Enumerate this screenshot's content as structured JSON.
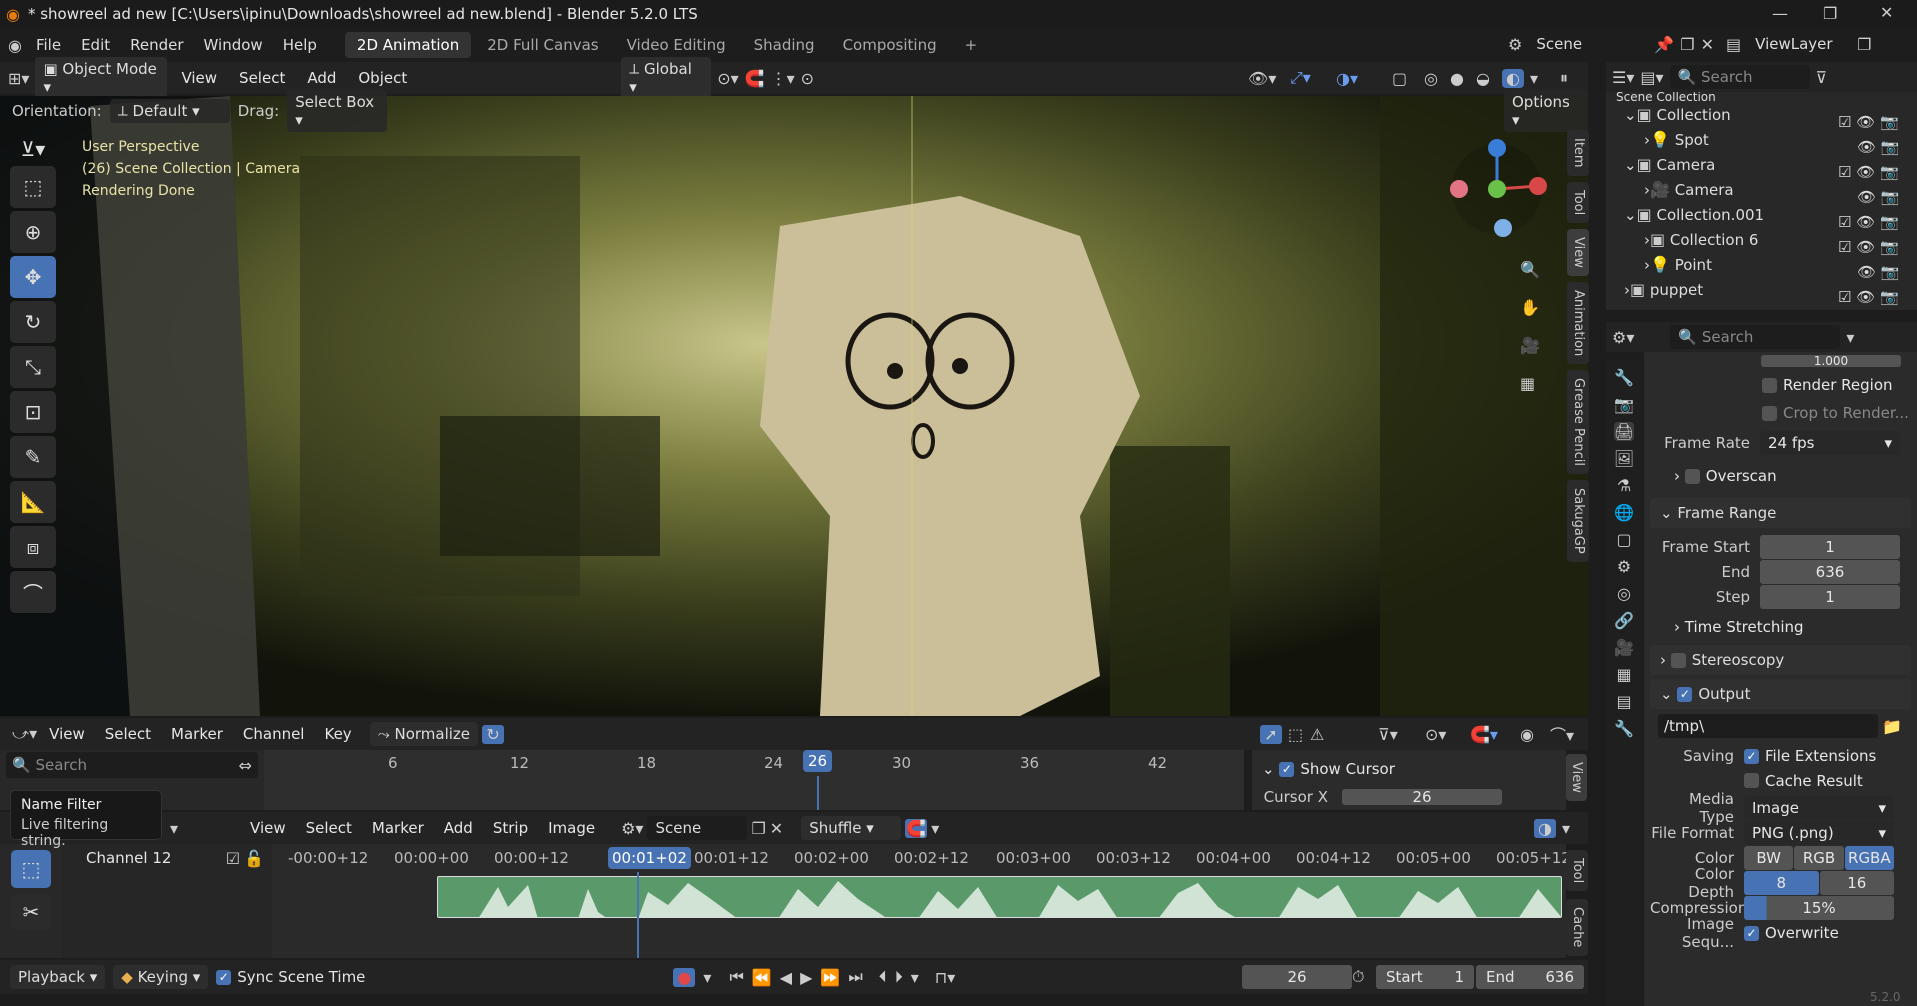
{
  "titlebar": {
    "title": "* showreel ad new [C:\\Users\\ipinu\\Downloads\\showreel ad new.blend] - Blender 5.2.0 LTS"
  },
  "menu": [
    "File",
    "Edit",
    "Render",
    "Window",
    "Help"
  ],
  "workspaces": [
    "2D Animation",
    "2D Full Canvas",
    "Video Editing",
    "Shading",
    "Compositing"
  ],
  "scene": {
    "name": "Scene",
    "viewlayer": "ViewLayer"
  },
  "viewport_header": {
    "mode": "Object Mode",
    "menus": [
      "View",
      "Select",
      "Add",
      "Object"
    ],
    "transform": "Global"
  },
  "tool_settings": {
    "orientation_label": "Orientation:",
    "orientation_value": "Default",
    "drag_label": "Drag:",
    "drag_value": "Select Box",
    "options": "Options"
  },
  "viewport_overlay": {
    "line1": "User Perspective",
    "line2": "(26) Scene Collection | Camera",
    "line3": "Rendering Done"
  },
  "sidebar_tabs": [
    "Item",
    "Tool",
    "View",
    "Animation",
    "Grease Pencil",
    "SakugaGP"
  ],
  "outliner": {
    "search_placeholder": "Search",
    "rows": [
      {
        "label": "Scene Collection"
      },
      {
        "label": "Collection"
      },
      {
        "label": "Spot"
      },
      {
        "label": "Camera"
      },
      {
        "label": "Camera"
      },
      {
        "label": "Collection.001"
      },
      {
        "label": "Collection 6"
      },
      {
        "label": "Point"
      },
      {
        "label": "puppet"
      }
    ]
  },
  "properties": {
    "search_placeholder": "Search",
    "res_value": "1.000",
    "render_region": "Render Region",
    "crop": "Crop to Render...",
    "frame_rate_label": "Frame Rate",
    "frame_rate_value": "24 fps",
    "overscan": "Overscan",
    "frame_range": "Frame Range",
    "frame_start_label": "Frame Start",
    "frame_start": "1",
    "end_label": "End",
    "end": "636",
    "step_label": "Step",
    "step": "1",
    "time_stretching": "Time Stretching",
    "stereoscopy": "Stereoscopy",
    "output": "Output",
    "path": "/tmp\\",
    "saving_label": "Saving",
    "file_ext": "File Extensions",
    "cache_result": "Cache Result",
    "media_type_label": "Media Type",
    "media_type": "Image",
    "file_format_label": "File Format",
    "file_format": "PNG (.png)",
    "color_label": "Color",
    "color_opts": [
      "BW",
      "RGB",
      "RGBA"
    ],
    "color_depth_label": "Color Depth",
    "depth_opts": [
      "8",
      "16"
    ],
    "compression_label": "Compression",
    "compression": "15%",
    "image_seq_label": "Image Sequ...",
    "overwrite": "Overwrite"
  },
  "graph_editor": {
    "menus": [
      "View",
      "Select",
      "Marker",
      "Channel",
      "Key"
    ],
    "normalize": "Normalize",
    "search_placeholder": "Search",
    "ticks": [
      "6",
      "12",
      "18",
      "24",
      "30",
      "36",
      "42"
    ],
    "current_frame": "26",
    "show_cursor": "Show Cursor",
    "cursor_x_label": "Cursor X",
    "cursor_x": "26",
    "tab": "View",
    "tooltip_title": "Name Filter",
    "tooltip_body": "Live filtering string."
  },
  "sequencer": {
    "menus": [
      "View",
      "Select",
      "Marker",
      "Add",
      "Strip",
      "Image"
    ],
    "scene": "Scene",
    "shuffle": "Shuffle",
    "channel": "Channel 12",
    "times": [
      "-00:00+12",
      "00:00+00",
      "00:00+12",
      "00:01+02",
      "00:01+12",
      "00:02+00",
      "00:02+12",
      "00:03+00",
      "00:03+12",
      "00:04+00",
      "00:04+12",
      "00:05+00",
      "00:05+12"
    ],
    "current_time": "00:01+02",
    "side_tabs": [
      "Tool",
      "Cache"
    ]
  },
  "timeline": {
    "playback": "Playback",
    "keying": "Keying",
    "sync": "Sync Scene Time",
    "frame": "26",
    "start_label": "Start",
    "start": "1",
    "end_label": "End",
    "end": "636"
  },
  "version": "5.2.0",
  "colors": {
    "accent": "#4772b3",
    "strip": "#5a9a6a"
  }
}
